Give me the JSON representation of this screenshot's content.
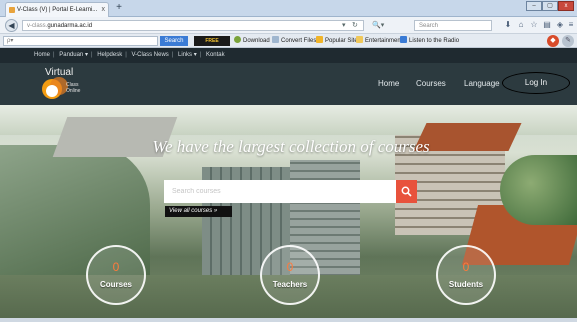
{
  "browser": {
    "tab_title": "V-Class (V) | Portal E-Learni...",
    "tab_close": "x",
    "new_tab": "+",
    "win_controls": [
      "–",
      "▢",
      "x"
    ],
    "url_prefix": "v-class.",
    "url_domain": "gunadarma.ac.id",
    "search_placeholder": "Search"
  },
  "toolbar": {
    "search_label": "Search",
    "logo": "FREE CONVERTER",
    "items": [
      "Download",
      "Convert Files",
      "Popular Sites",
      "Entertainment",
      "Listen to the Radio"
    ]
  },
  "topbar": {
    "links": [
      "Home",
      "Panduan ▾",
      "Helpdesk",
      "V-Class News",
      "Links ▾",
      "Kontak"
    ]
  },
  "header": {
    "logo_title": "Virtual",
    "logo_sub_1": "Class",
    "logo_sub_2": "Online",
    "nav": [
      "Home",
      "Courses",
      "Language"
    ],
    "login": "Log In"
  },
  "hero": {
    "title": "We have the largest collection of courses",
    "search_placeholder": "Search courses",
    "view_all": "View all courses »",
    "stats": [
      {
        "value": "0",
        "label": "Courses"
      },
      {
        "value": "0",
        "label": "Teachers"
      },
      {
        "value": "0",
        "label": "Students"
      }
    ]
  },
  "colors": {
    "accent": "#e8523c",
    "header_bg": "#2c3a3f",
    "topbar_bg": "#1f2a30",
    "stat_number": "#ff7a3c"
  }
}
